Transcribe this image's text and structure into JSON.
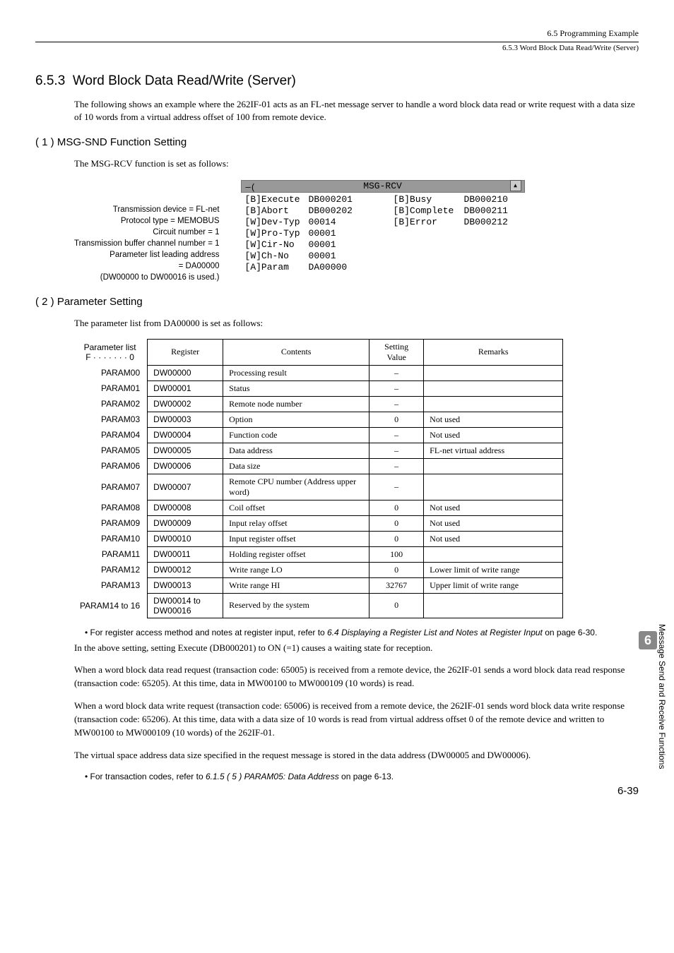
{
  "header": {
    "right1": "6.5  Programming Example",
    "right2": "6.5.3  Word Block Data Read/Write (Server)"
  },
  "section": {
    "number": "6.5.3",
    "title": "Word Block Data Read/Write (Server)",
    "intro": "The following shows an example where the 262IF-01 acts as an FL-net message server to handle a word block data read or write request with a data size of 10 words from a virtual address offset of 100 from remote device."
  },
  "sub1": {
    "heading": "( 1 )  MSG-SND Function Setting",
    "intro": "The MSG-RCV function is set as follows:",
    "labels": [
      "Transmission device = FL-net",
      "Protocol type = MEMOBUS",
      "Circuit number = 1",
      "Transmission buffer channel number = 1",
      "Parameter list leading address"
    ],
    "extra1": "= DA00000",
    "extra2": "(DW00000 to DW00016 is used.)",
    "box_title": "MSG-RCV",
    "left_rows": [
      {
        "k": "[B]Execute",
        "v": "DB000201"
      },
      {
        "k": "[B]Abort",
        "v": "DB000202"
      },
      {
        "k": "[W]Dev-Typ",
        "v": "00014"
      },
      {
        "k": "[W]Pro-Typ",
        "v": "00001"
      },
      {
        "k": "[W]Cir-No",
        "v": "00001"
      },
      {
        "k": "[W]Ch-No",
        "v": "00001"
      },
      {
        "k": "[A]Param",
        "v": "DA00000"
      }
    ],
    "right_rows": [
      {
        "k": "[B]Busy",
        "v": "DB000210"
      },
      {
        "k": "[B]Complete",
        "v": "DB000211"
      },
      {
        "k": "[B]Error",
        "v": "DB000212"
      }
    ]
  },
  "sub2": {
    "heading": "( 2 )  Parameter Setting",
    "intro": "The parameter list from DA00000 is set as follows:",
    "head_paramlist_top": "Parameter list",
    "head_paramlist_bot": "F · · · · · · · 0",
    "head_register": "Register",
    "head_contents": "Contents",
    "head_setting_top": "Setting",
    "head_setting_bot": "Value",
    "head_remarks": "Remarks",
    "rows": [
      {
        "p": "PARAM00",
        "r": "DW00000",
        "c": "Processing result",
        "v": "–",
        "rm": ""
      },
      {
        "p": "PARAM01",
        "r": "DW00001",
        "c": "Status",
        "v": "–",
        "rm": ""
      },
      {
        "p": "PARAM02",
        "r": "DW00002",
        "c": "Remote node number",
        "v": "–",
        "rm": ""
      },
      {
        "p": "PARAM03",
        "r": "DW00003",
        "c": "Option",
        "v": "0",
        "rm": "Not used"
      },
      {
        "p": "PARAM04",
        "r": "DW00004",
        "c": "Function code",
        "v": "–",
        "rm": "Not used"
      },
      {
        "p": "PARAM05",
        "r": "DW00005",
        "c": "Data address",
        "v": "–",
        "rm": "FL-net virtual address"
      },
      {
        "p": "PARAM06",
        "r": "DW00006",
        "c": "Data size",
        "v": "–",
        "rm": ""
      },
      {
        "p": "PARAM07",
        "r": "DW00007",
        "c": "Remote CPU number (Address upper word)",
        "v": "–",
        "rm": ""
      },
      {
        "p": "PARAM08",
        "r": "DW00008",
        "c": "Coil offset",
        "v": "0",
        "rm": "Not used"
      },
      {
        "p": "PARAM09",
        "r": "DW00009",
        "c": "Input relay offset",
        "v": "0",
        "rm": "Not used"
      },
      {
        "p": "PARAM10",
        "r": "DW00010",
        "c": "Input register offset",
        "v": "0",
        "rm": "Not used"
      },
      {
        "p": "PARAM11",
        "r": "DW00011",
        "c": "Holding register offset",
        "v": "100",
        "rm": ""
      },
      {
        "p": "PARAM12",
        "r": "DW00012",
        "c": "Write range LO",
        "v": "0",
        "rm": "Lower limit of write range"
      },
      {
        "p": "PARAM13",
        "r": "DW00013",
        "c": "Write range HI",
        "v": "32767",
        "rm": "Upper limit of write range"
      },
      {
        "p": "PARAM14 to 16",
        "r": "DW00014 to DW00016",
        "c": "Reserved by the system",
        "v": "0",
        "rm": ""
      }
    ]
  },
  "notes": {
    "bullet1_pre": "For register access method and notes at register input, refer to ",
    "bullet1_ref": "6.4 Displaying a Register List and Notes at Register Input",
    "bullet1_post": " on page 6-30.",
    "para1": "In the above setting, setting Execute (DB000201) to ON (=1) causes a waiting state for reception.",
    "para2": "When a word block data read request (transaction code: 65005) is received from a remote device, the 262IF-01 sends a word block data read response (transaction code: 65205). At this time, data in MW00100 to MW000109 (10 words) is read.",
    "para3": "When a word block data write request (transaction code: 65006) is received from a remote device, the 262IF-01 sends word block data write response (transaction code: 65206). At this time, data with a data size of 10 words is read from virtual address offset 0 of the remote device and written to MW00100 to MW000109 (10 words) of the 262IF-01.",
    "para4": "The virtual space address data size specified in the request message is stored in the data address (DW00005 and DW00006).",
    "bullet2_pre": "For transaction codes, refer to ",
    "bullet2_ref": "6.1.5 ( 5 ) PARAM05: Data Address",
    "bullet2_post": " on page 6-13."
  },
  "side": {
    "label": "Message Send and Receive Functions",
    "chapter": "6"
  },
  "pagenum": "6-39"
}
